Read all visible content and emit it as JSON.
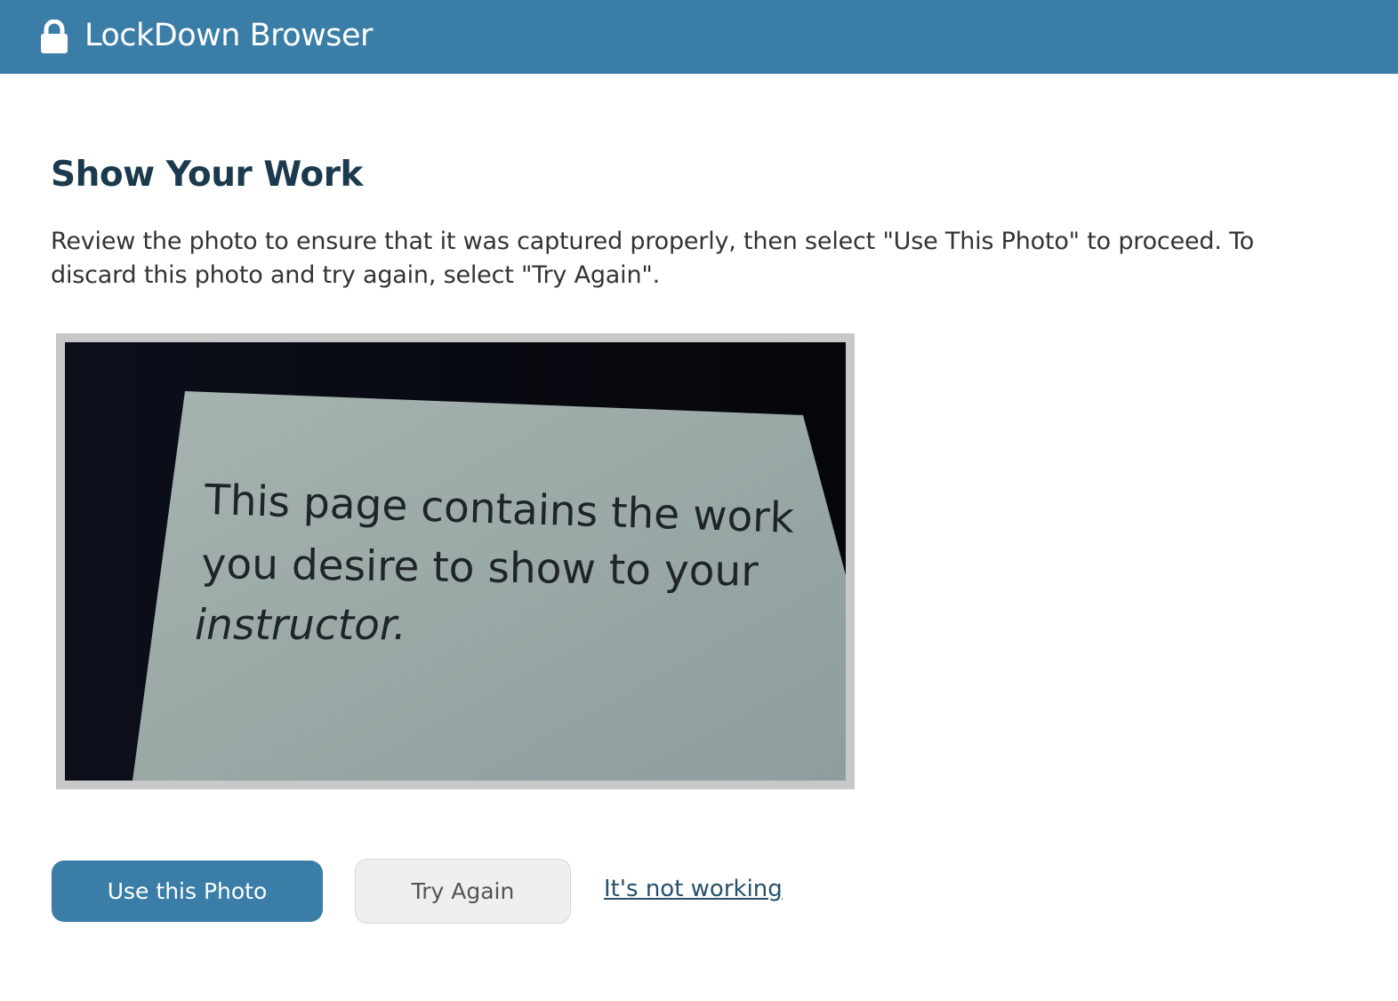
{
  "header": {
    "app_title": "LockDown Browser",
    "icon": "lock-icon",
    "background_color": "#3a7ea8"
  },
  "main": {
    "title": "Show Your Work",
    "instructions": "Review the photo to ensure that it was captured properly, then select \"Use This Photo\" to proceed. To discard this photo and try again, select \"Try Again\".",
    "photo": {
      "text_lines": [
        "This page contains the work",
        "you desire to show to your",
        "instructor."
      ]
    }
  },
  "actions": {
    "use_photo_label": "Use this Photo",
    "try_again_label": "Try Again",
    "not_working_label": "It's not working",
    "primary_color": "#3a7ea8"
  }
}
